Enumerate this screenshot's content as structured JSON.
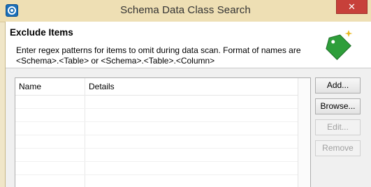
{
  "window": {
    "title": "Schema Data Class Search",
    "close_glyph": "✕"
  },
  "banner": {
    "title": "Exclude Items",
    "description": "Enter regex patterns for items to omit during data scan. Format of names are <Schema>.<Table> or <Schema>.<Table>.<Column>",
    "icon": "green-tag-icon"
  },
  "table": {
    "columns": [
      "Name",
      "Details"
    ],
    "rows": []
  },
  "buttons": {
    "add": "Add...",
    "browse": "Browse...",
    "edit": "Edit...",
    "remove": "Remove"
  },
  "colors": {
    "titlebar": "#eedfb4",
    "close": "#c7403a",
    "tag": "#2e9e3a"
  }
}
